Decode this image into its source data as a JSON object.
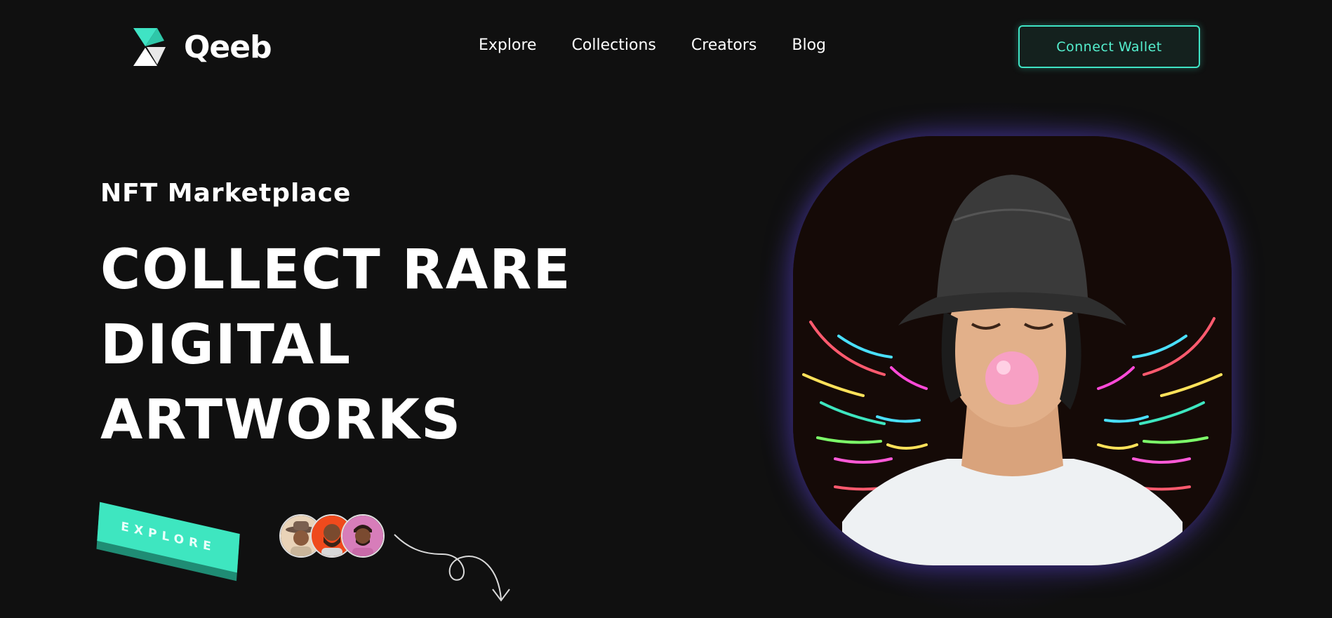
{
  "header": {
    "brand": "Qeeb",
    "nav": [
      "Explore",
      "Collections",
      "Creators",
      "Blog"
    ],
    "wallet_label": "Connect Wallet"
  },
  "hero": {
    "kicker": "NFT Marketplace",
    "headline": [
      "COLLECT RARE",
      "DIGITAL",
      "ARTWORKS"
    ],
    "explore_label": "EXPLORE"
  },
  "colors": {
    "background": "#101010",
    "accent": "#3fe3c4",
    "glow": "#5a3cdc"
  },
  "icons": {
    "logo": "triangle-logo-icon",
    "arrow": "curly-arrow-down-icon"
  }
}
